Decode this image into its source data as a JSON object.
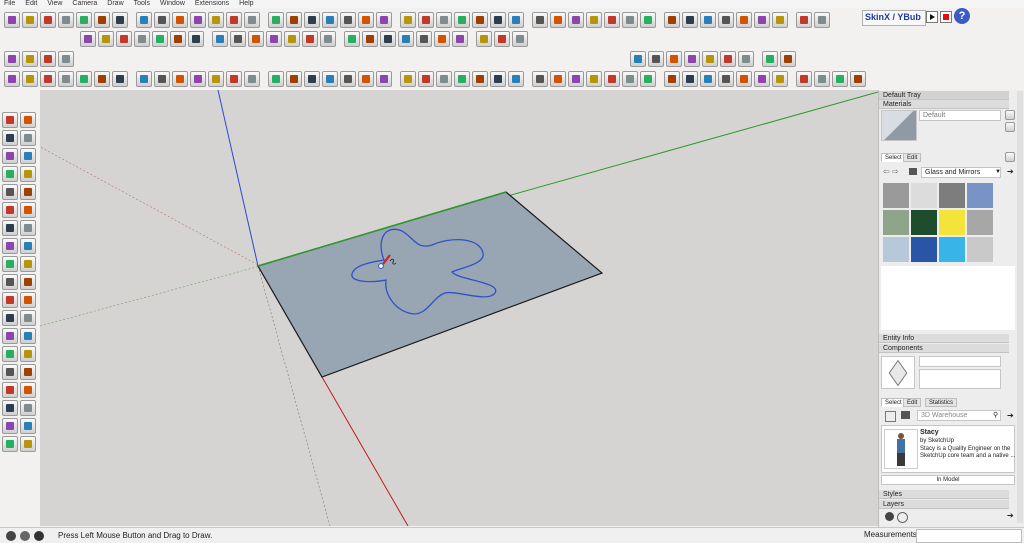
{
  "menu": [
    "File",
    "Edit",
    "View",
    "Camera",
    "Draw",
    "Tools",
    "Window",
    "Extensions",
    "Help"
  ],
  "toolbar": {
    "skin_label": "SkinX / YBub"
  },
  "status": {
    "hint": "Press Left Mouse Button and Drag to Draw.",
    "measurements_label": "Measurements"
  },
  "tray": {
    "title": "Default Tray",
    "materials": {
      "header": "Materials",
      "material_name": "Default",
      "tab_select": "Select",
      "tab_edit": "Edit",
      "library": "Glass and Mirrors",
      "swatch_colors": [
        "#9a9a9a",
        "#dcdcdc",
        "#7d7d7d",
        "#7a93c7",
        "#8ea58b",
        "#1d4d2d",
        "#f4e43a",
        "#a7a7a7",
        "#b6c8da",
        "#2a55a6",
        "#38b4e8",
        "#c9c9c9"
      ]
    },
    "entity_info": "Entity Info",
    "components": {
      "header": "Components",
      "tab_select": "Select",
      "tab_edit": "Edit",
      "tab_statistics": "Statistics",
      "search_placeholder": "3D Warehouse",
      "item_name": "Stacy",
      "item_by": "by SketchUp",
      "item_desc_1": "Stacy is a Quality Engineer on the",
      "item_desc_2": "SketchUp core team and a native ...",
      "in_model": "In Model"
    },
    "styles": "Styles",
    "layers": "Layers"
  },
  "colors": {
    "viewport_bg": "#d6d4d2",
    "face": "#98a6b3",
    "axis_red": "#c41b1b",
    "axis_green": "#2b9a2b",
    "axis_blue": "#2b48d6",
    "sketch_line": "#2f50c8"
  }
}
